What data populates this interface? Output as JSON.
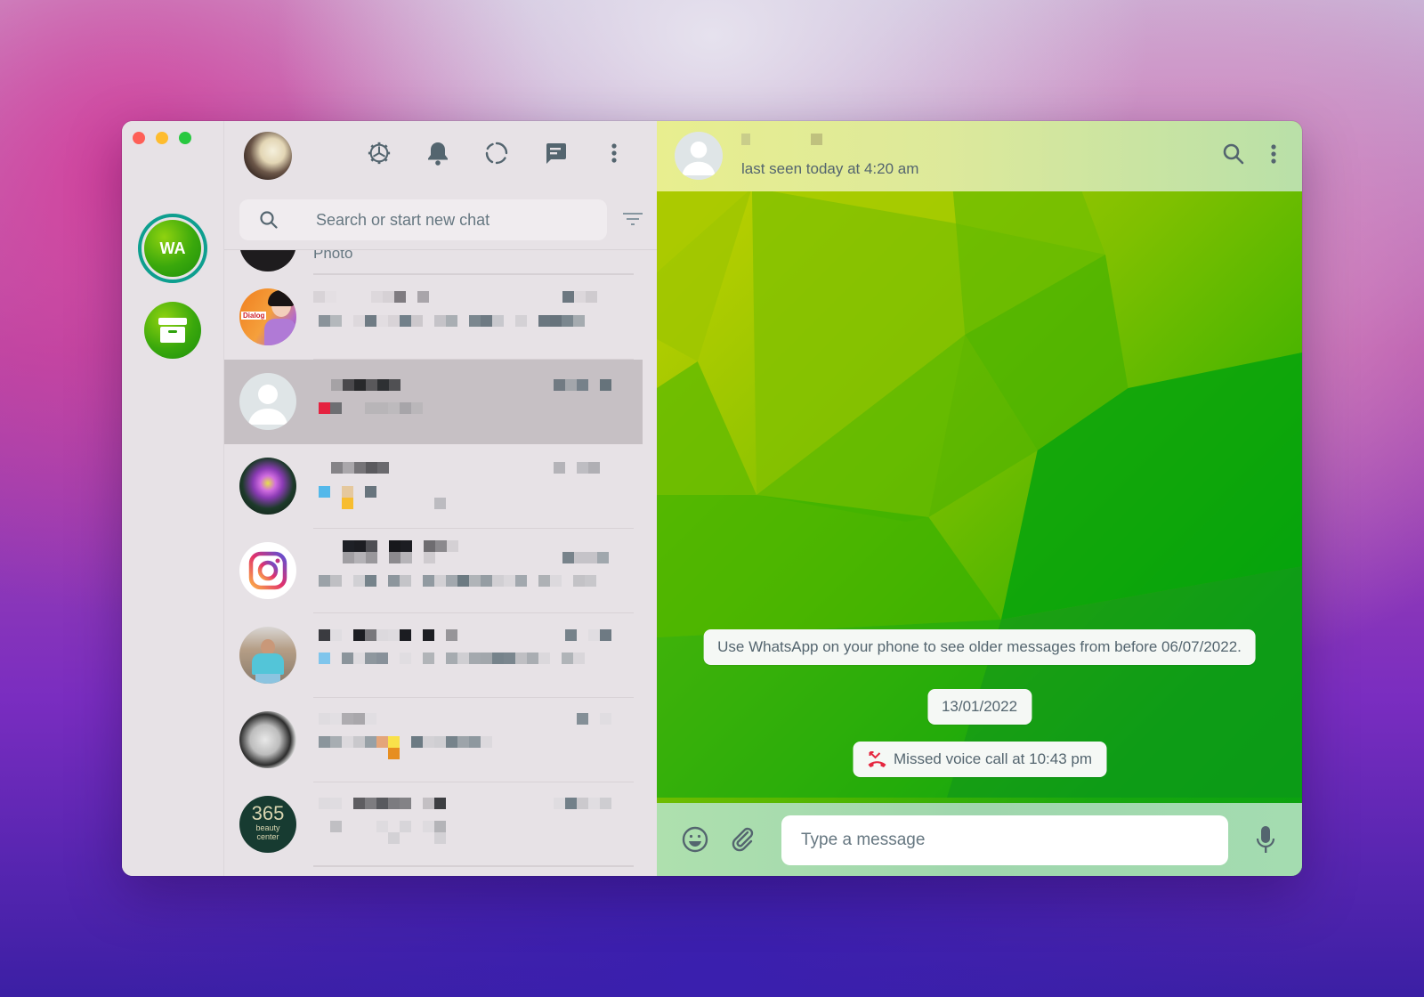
{
  "window": {
    "traffic_lights": [
      "close",
      "minimize",
      "zoom"
    ]
  },
  "rail": {
    "account_label": "WA",
    "archive_icon": "archive-box-icon"
  },
  "list_header": {
    "icons": [
      "settings-gear-icon",
      "bell-icon",
      "status-ring-icon",
      "new-chat-icon",
      "more-vert-icon"
    ]
  },
  "search": {
    "placeholder": "Search or start new chat",
    "value": "",
    "filter_icon": "filter-icon"
  },
  "chats": [
    {
      "avatar": "dark",
      "preview_label": "Photo",
      "partial": true,
      "selected": false
    },
    {
      "avatar": "dialog-logo",
      "avatar_text": "Dialog",
      "selected": false,
      "redacted": true
    },
    {
      "avatar": "default-person",
      "selected": true,
      "redacted": true
    },
    {
      "avatar": "purple-flower",
      "selected": false,
      "redacted": true
    },
    {
      "avatar": "instagram-logo",
      "selected": false,
      "redacted": true
    },
    {
      "avatar": "man-photo",
      "selected": false,
      "redacted": true
    },
    {
      "avatar": "woman-photo",
      "selected": false,
      "redacted": true
    },
    {
      "avatar": "beauty-center-logo",
      "avatar_text_big": "365",
      "avatar_text_small1": "beauty",
      "avatar_text_small2": "center",
      "selected": false,
      "redacted": true
    }
  ],
  "conversation": {
    "contact_name_redacted": true,
    "last_seen": "last seen today at 4:20 am",
    "header_icons": [
      "search-icon",
      "more-vert-icon"
    ],
    "system_notice": "Use WhatsApp on your phone to see older messages from before 06/07/2022.",
    "date_divider": "13/01/2022",
    "missed_call": "Missed voice call at 10:43 pm",
    "missed_call_color": "#e5263f"
  },
  "composer": {
    "placeholder": "Type a message",
    "value": "",
    "icons": [
      "emoji-icon",
      "attach-icon",
      "microphone-icon"
    ]
  },
  "colors": {
    "accent_ring": "#0e9f8f",
    "icon_gray": "#54656f"
  }
}
